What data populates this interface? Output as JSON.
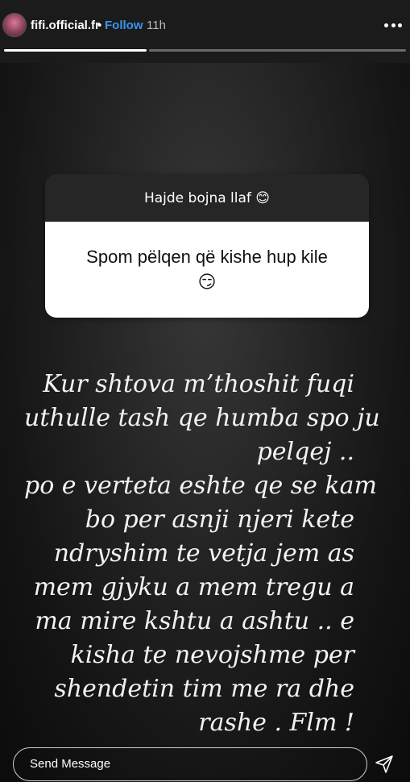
{
  "header": {
    "username": "fifi.official.fr",
    "separator": "•",
    "follow_label": "Follow",
    "time_ago": "11h",
    "progress": {
      "total_segments": 2,
      "current_segment": 1
    }
  },
  "question_card": {
    "prompt": "Hajde bojna llaf 😊",
    "answer_line1": "Spom pëlqen që kishe hup kile",
    "answer_emoji": "😏"
  },
  "caption_lines": [
    "Kur shtova m’thoshit fuqi",
    "uthulle tash qe humba spo ju",
    "pelqej ..",
    "po e verteta eshte qe se kam",
    "bo per asnji njeri kete",
    "ndryshim te vetja jem as",
    "mem gjyku a mem tregu a",
    "ma mire kshtu a ashtu .. e",
    "kisha te nevojshme per",
    "shendetin tim me ra dhe",
    "rashe . Flm !"
  ],
  "footer": {
    "message_placeholder": "Send Message"
  },
  "colors": {
    "follow": "#3897f0",
    "card_top": "#262626",
    "card_bottom": "#ffffff"
  }
}
